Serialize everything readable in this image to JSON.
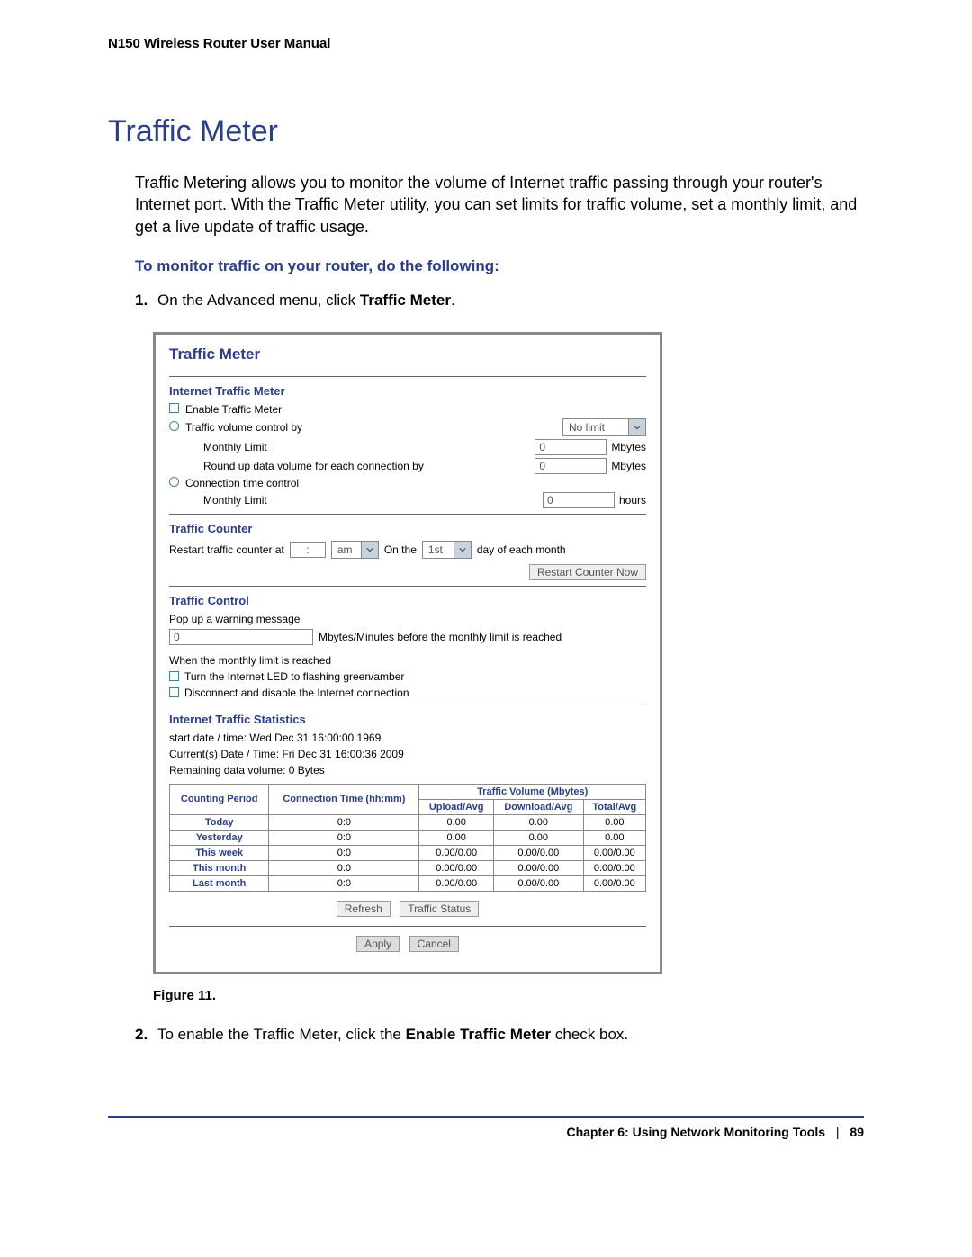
{
  "header": {
    "manual_title": "N150 Wireless Router User Manual"
  },
  "section": {
    "title": "Traffic Meter",
    "intro": "Traffic Metering allows you to monitor the volume of Internet traffic passing through your router's Internet port. With the Traffic Meter utility, you can set limits for traffic volume, set a monthly limit, and get a live update of traffic usage.",
    "instruction_heading": "To monitor traffic on your router, do the following:",
    "steps": {
      "one": {
        "num": "1.",
        "pre": "On the Advanced menu, click ",
        "bold": "Traffic Meter",
        "post": "."
      },
      "two": {
        "num": "2.",
        "pre": "To enable the Traffic Meter, click the ",
        "bold": "Enable Traffic Meter",
        "post": " check box."
      }
    },
    "figure_caption": "Figure 11."
  },
  "screenshot": {
    "panel_title": "Traffic Meter",
    "internet_meter": {
      "heading": "Internet Traffic Meter",
      "enable_label": "Enable Traffic Meter",
      "volume_label": "Traffic volume control by",
      "volume_select": "No limit",
      "monthly_limit_label": "Monthly Limit",
      "monthly_limit_value": "0",
      "monthly_limit_unit": "Mbytes",
      "roundup_label": "Round up data volume for each connection by",
      "roundup_value": "0",
      "roundup_unit": "Mbytes",
      "conn_time_label": "Connection time control",
      "conn_monthly_label": "Monthly Limit",
      "conn_monthly_value": "0",
      "conn_monthly_unit": "hours"
    },
    "counter": {
      "heading": "Traffic Counter",
      "restart_label": "Restart traffic counter at",
      "time_value": ":",
      "ampm": "am",
      "on_the": "On the",
      "day_select": "1st",
      "day_suffix": "day of each month",
      "restart_btn": "Restart Counter Now"
    },
    "control": {
      "heading": "Traffic Control",
      "popup_label": "Pop up a warning message",
      "popup_value": "0",
      "popup_suffix": "Mbytes/Minutes before the monthly limit is reached",
      "when_reached": "When the monthly limit is reached",
      "led_label": "Turn the Internet LED to flashing green/amber",
      "disconnect_label": "Disconnect and disable the Internet connection"
    },
    "stats": {
      "heading": "Internet Traffic Statistics",
      "start": "start date / time: Wed Dec 31 16:00:00 1969",
      "current": "Current(s) Date / Time: Fri Dec 31 16:00:36 2009",
      "remaining": "Remaining data volume: 0 Bytes",
      "refresh_btn": "Refresh",
      "status_btn": "Traffic Status",
      "apply_btn": "Apply",
      "cancel_btn": "Cancel"
    },
    "table": {
      "head_period": "Counting Period",
      "head_conn": "Connection Time (hh:mm)",
      "head_volume": "Traffic Volume (Mbytes)",
      "head_upload": "Upload/Avg",
      "head_download": "Download/Avg",
      "head_total": "Total/Avg",
      "rows": [
        {
          "period": "Today",
          "conn": "0:0",
          "up": "0.00",
          "down": "0.00",
          "total": "0.00"
        },
        {
          "period": "Yesterday",
          "conn": "0:0",
          "up": "0.00",
          "down": "0.00",
          "total": "0.00"
        },
        {
          "period": "This week",
          "conn": "0:0",
          "up": "0.00/0.00",
          "down": "0.00/0.00",
          "total": "0.00/0.00"
        },
        {
          "period": "This month",
          "conn": "0:0",
          "up": "0.00/0.00",
          "down": "0.00/0.00",
          "total": "0.00/0.00"
        },
        {
          "period": "Last month",
          "conn": "0:0",
          "up": "0.00/0.00",
          "down": "0.00/0.00",
          "total": "0.00/0.00"
        }
      ]
    }
  },
  "footer": {
    "chapter": "Chapter 6:  Using Network Monitoring Tools",
    "page": "89"
  }
}
